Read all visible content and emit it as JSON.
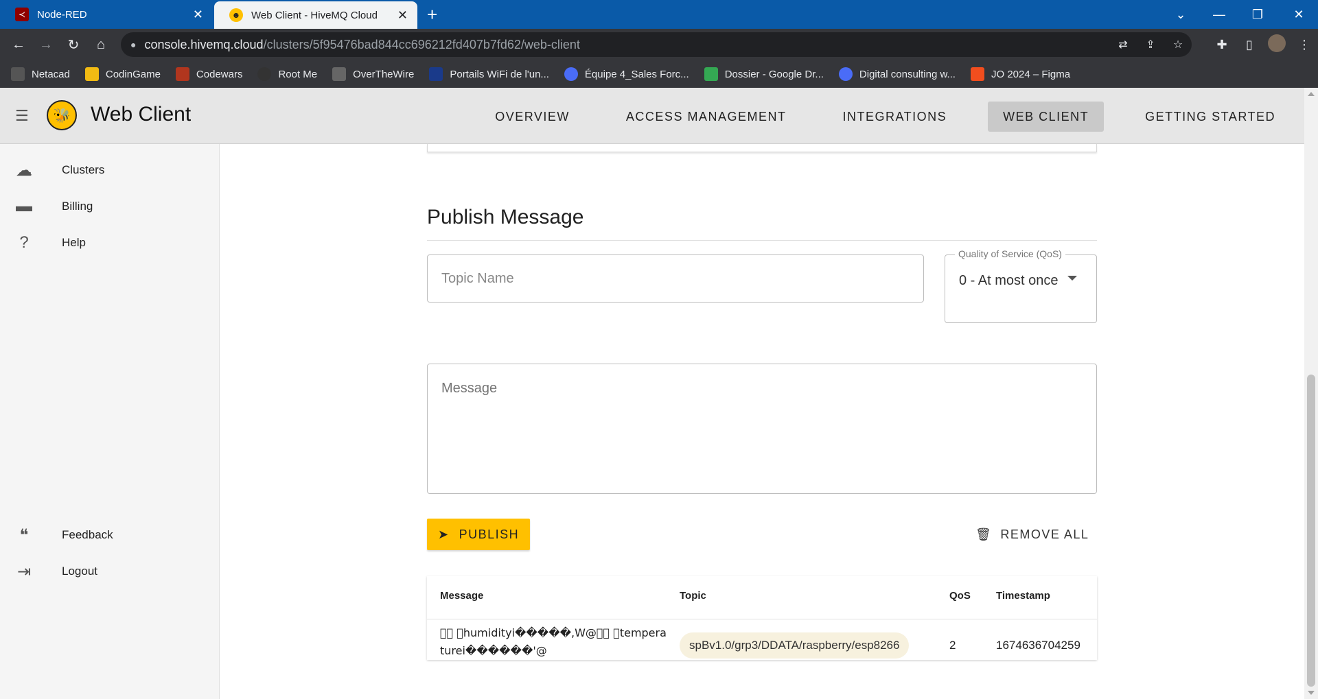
{
  "browser": {
    "tabs": [
      {
        "title": "Node-RED",
        "icon": "node-red-icon",
        "close": "✕"
      },
      {
        "title": "Web Client - HiveMQ Cloud",
        "icon": "hivemq-icon",
        "close": "✕"
      }
    ],
    "new_tab": "+",
    "url_host": "console.hivemq.cloud",
    "url_path": "/clusters/5f95476bad844cc696212fd407b7fd62/web-client",
    "bookmarks": [
      {
        "label": "Netacad",
        "color": "#555555"
      },
      {
        "label": "CodinGame",
        "color": "#f2bb13"
      },
      {
        "label": "Codewars",
        "color": "#b1361e"
      },
      {
        "label": "Root Me",
        "color": "#333333"
      },
      {
        "label": "OverTheWire",
        "color": "#666666"
      },
      {
        "label": "Portails WiFi de l'un...",
        "color": "#1a3a8a"
      },
      {
        "label": "Équipe 4_Sales Forc...",
        "color": "#4a6cf7"
      },
      {
        "label": "Dossier - Google Dr...",
        "color": "#34a853"
      },
      {
        "label": "Digital consulting w...",
        "color": "#4a6cf7"
      },
      {
        "label": "JO 2024 – Figma",
        "color": "#f24e1e"
      }
    ]
  },
  "app": {
    "title": "Web Client",
    "brand_color": "#ffc000",
    "nav": [
      {
        "label": "OVERVIEW",
        "active": false
      },
      {
        "label": "ACCESS MANAGEMENT",
        "active": false
      },
      {
        "label": "INTEGRATIONS",
        "active": false
      },
      {
        "label": "WEB CLIENT",
        "active": true
      },
      {
        "label": "GETTING STARTED",
        "active": false
      }
    ]
  },
  "sidebar": {
    "items": [
      {
        "label": "Clusters",
        "icon": "cloud-icon"
      },
      {
        "label": "Billing",
        "icon": "credit-card-icon"
      },
      {
        "label": "Help",
        "icon": "help-circle-icon"
      },
      {
        "label": "Feedback",
        "icon": "feedback-icon"
      },
      {
        "label": "Logout",
        "icon": "logout-icon"
      }
    ]
  },
  "publish": {
    "title": "Publish Message",
    "topic_placeholder": "Topic Name",
    "qos_label": "Quality of Service (QoS)",
    "qos_value": "0 - At most once",
    "message_placeholder": "Message",
    "publish_label": "PUBLISH",
    "remove_all_label": "REMOVE ALL"
  },
  "table": {
    "headers": [
      "Message",
      "Topic",
      "QoS",
      "Timestamp"
    ],
    "rows": [
      {
        "message": "\u0000\u0000 \u0000humidityi�����,W@\u0000\u0000 \u0000temperaturei������'@",
        "topic": "spBv1.0/grp3/DDATA/raspberry/esp8266",
        "qos": "2",
        "timestamp": "1674636704259"
      }
    ]
  }
}
